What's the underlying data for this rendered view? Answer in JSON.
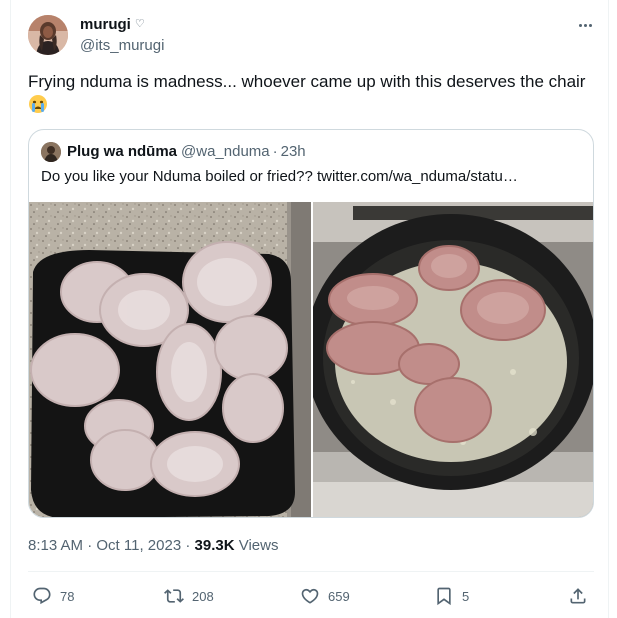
{
  "tweet": {
    "author_name": "murugi",
    "author_handle": "@its_murugi",
    "text": "Frying nduma is madness... whoever came up with this deserves the chair",
    "emoji": "crying-face-emoji"
  },
  "quoted": {
    "name": "Plug wa ndūma",
    "handle": "@wa_nduma",
    "separator": "·",
    "time": "23h",
    "text": "Do you like your Nduma boiled or fried??  twitter.com/wa_nduma/statu…"
  },
  "meta": {
    "time": "8:13 AM",
    "separator": "·",
    "date": "Oct 11, 2023",
    "views_count": "39.3K",
    "views_label": "Views"
  },
  "actions": {
    "replies": "78",
    "reposts": "208",
    "likes": "659",
    "bookmarks": "5"
  },
  "colors": {
    "text_primary": "#0f1419",
    "text_secondary": "#536471",
    "border": "#cfd9de",
    "divider": "#eff3f4"
  },
  "icons": [
    "heart-icon",
    "more-icon",
    "reply-icon",
    "retweet-icon",
    "like-icon",
    "bookmark-icon",
    "share-icon"
  ]
}
